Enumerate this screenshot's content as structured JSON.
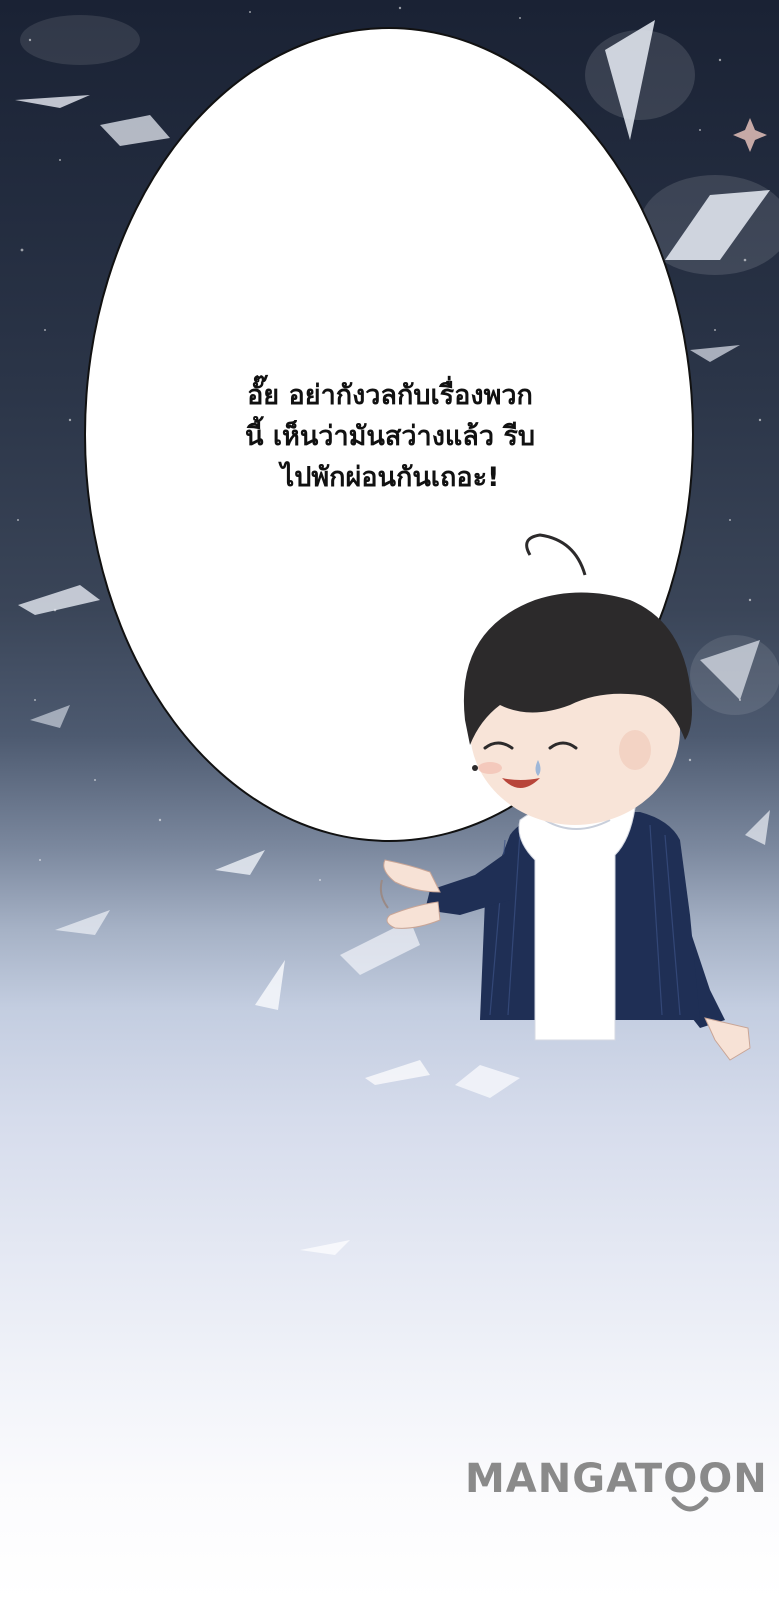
{
  "speech": {
    "line1": "อั๊ย อย่ากังวลกับเรื่องพวก",
    "line2": "นี้ เห็นว่ามันสว่างแล้ว รีบ",
    "line3": "ไปพักผ่อนกันเถอะ!"
  },
  "watermark": {
    "text": "MANGATOON"
  },
  "colors": {
    "night_sky": "#1a2234",
    "lower_sky": "#e4e8f3",
    "jacket": "#1f2f55",
    "hair": "#2c2a2b",
    "watermark": "#8a8a8a"
  }
}
